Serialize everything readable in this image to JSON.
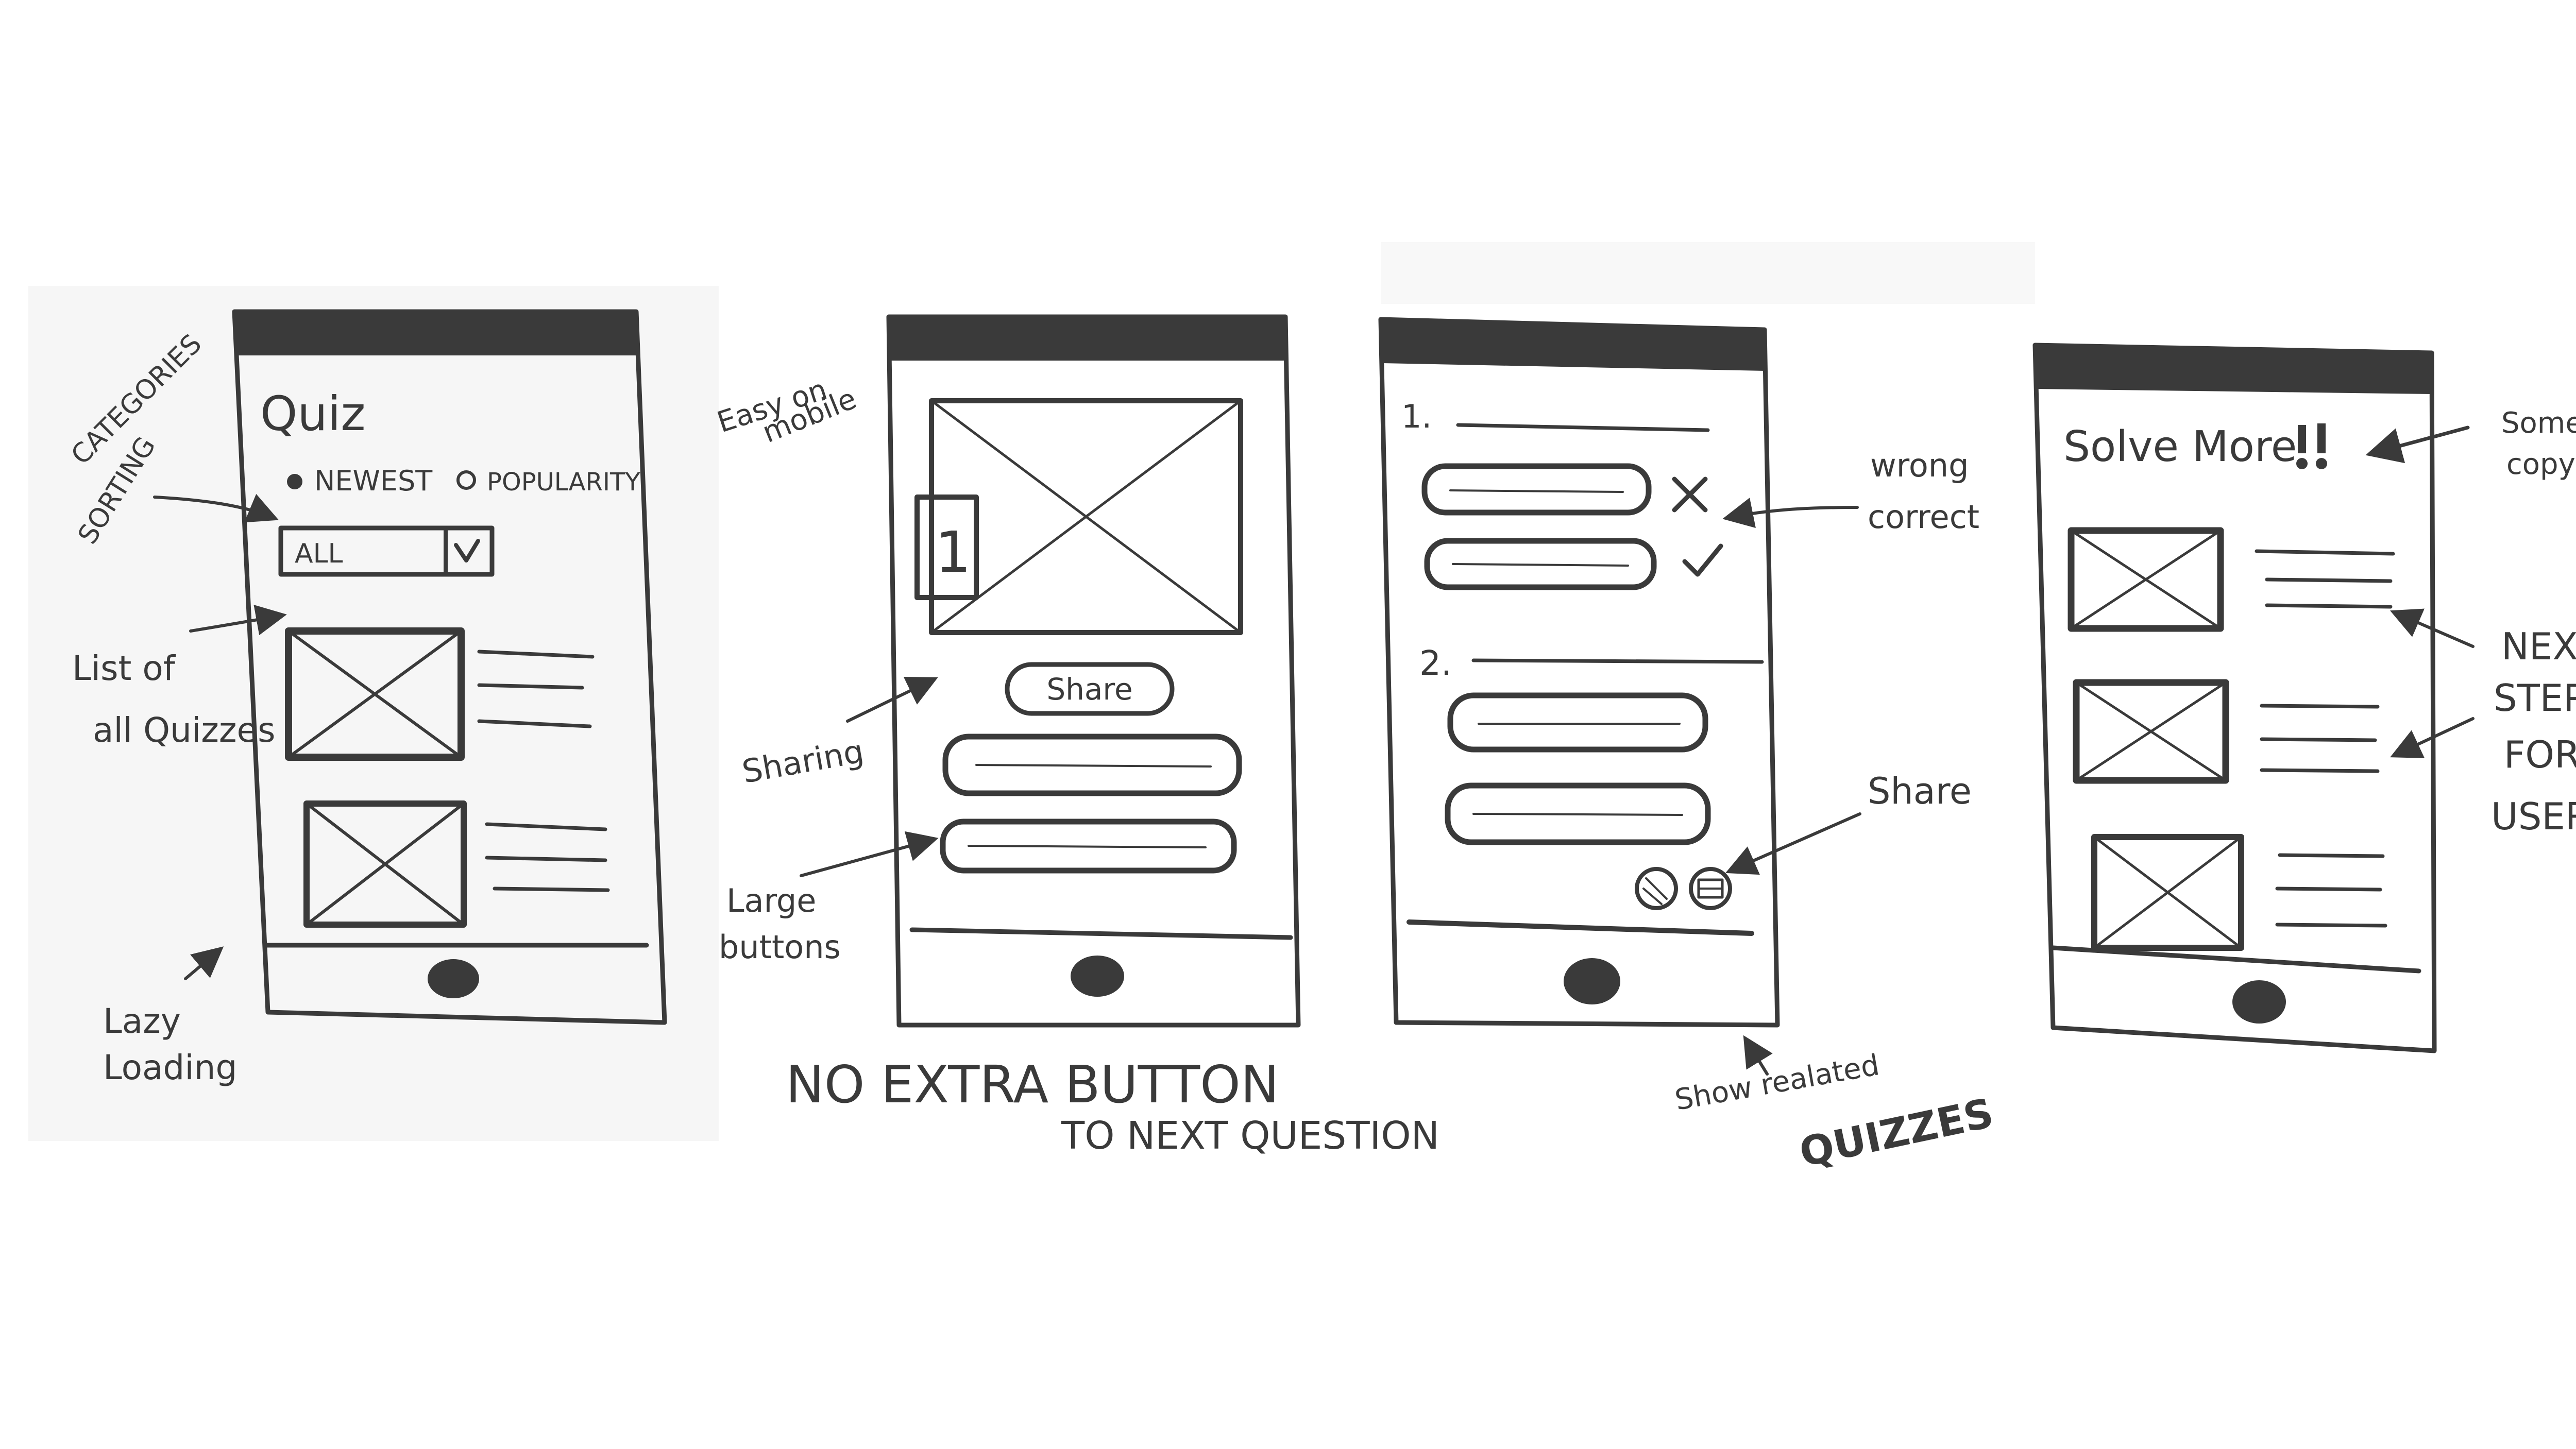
{
  "screen1": {
    "title": "Quiz",
    "sort_newest": "NEWEST",
    "sort_popularity": "POPULARITY",
    "category_select": "ALL",
    "category_select_chevron": "chevron-down-icon"
  },
  "screen2": {
    "question_number": "1",
    "share_button": "Share"
  },
  "screen3": {
    "question1_number": "1.",
    "question2_number": "2.",
    "wrong_mark": "close-icon",
    "correct_mark": "check-icon"
  },
  "screen4": {
    "title": "Solve More"
  },
  "annotations": {
    "categories": "CATEGORIES",
    "sorting": "SORTING",
    "list_of": "List of",
    "all_quizzes": "all Quizzes",
    "lazy": "Lazy",
    "loading": "Loading",
    "easy_on": "Easy on",
    "mobile": "mobile",
    "sharing": "Sharing",
    "large": "Large",
    "buttons": "buttons",
    "no_extra_button": "NO EXTRA BUTTON",
    "to_next_question": "TO NEXT QUESTION",
    "wrong": "wrong",
    "correct": "correct",
    "share": "Share",
    "show_related": "Show realated",
    "quizzes": "QUIZZES",
    "some": "Some",
    "copy": "copy",
    "next": "NEXT",
    "step": "STEP",
    "for": "FOR",
    "user": "USER"
  }
}
